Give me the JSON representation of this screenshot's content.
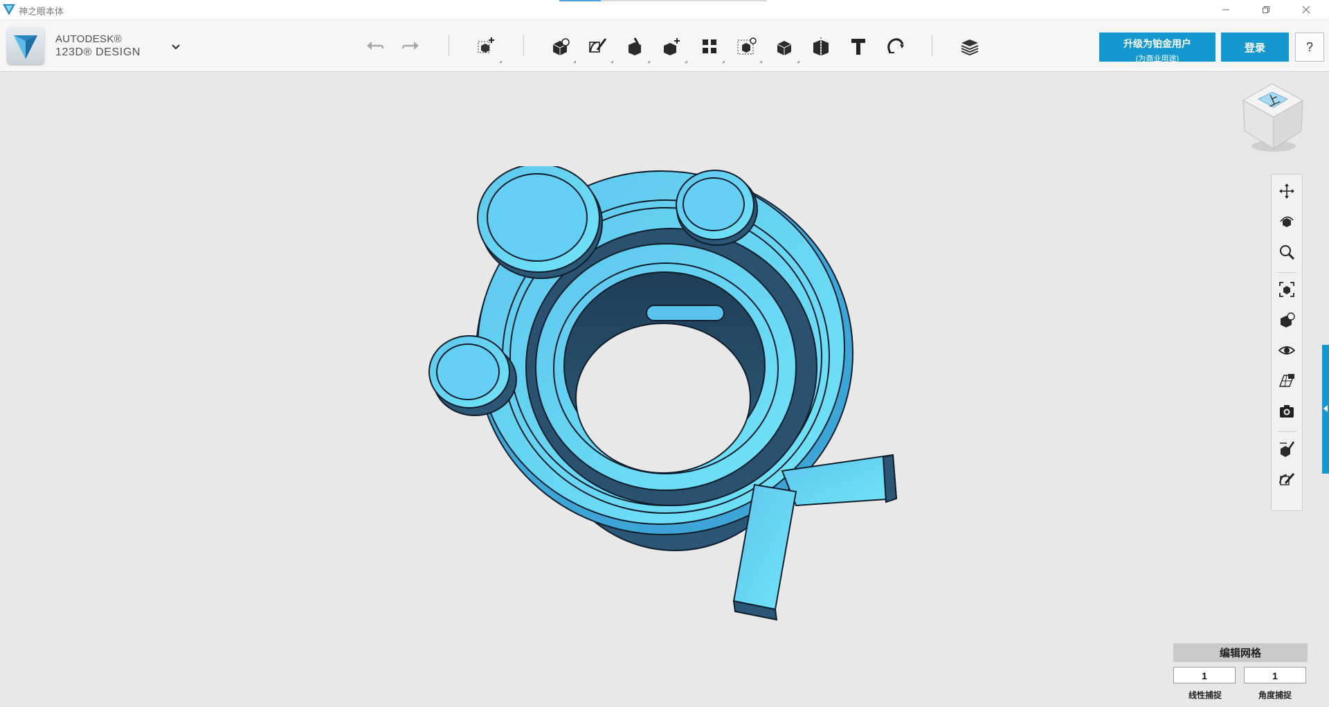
{
  "window": {
    "title": "神之眼本体",
    "controls": [
      "minimize-icon",
      "restore-icon",
      "close-icon"
    ]
  },
  "branding": {
    "line1": "AUTODESK®",
    "line2": "123D® DESIGN",
    "menu_icon": "chevron-down-icon"
  },
  "toolbar": {
    "history": [
      "undo-icon",
      "redo-icon"
    ],
    "groups": [
      [
        "transform-icon"
      ],
      [
        "primitives-icon",
        "sketch-icon",
        "construct-icon",
        "modify-icon",
        "pattern-icon",
        "grouping-icon",
        "combine-icon",
        "measure-icon",
        "text-icon",
        "snap-icon"
      ],
      [
        "material-icon"
      ]
    ],
    "upgrade_label": "升级为铂金用户",
    "upgrade_sublabel": "(为商业用途)",
    "login_label": "登录",
    "help_label": "?"
  },
  "view_cube": {
    "face": "上"
  },
  "navigation": {
    "tools": [
      "pan-icon",
      "orbit-icon",
      "zoom-icon",
      "fit-icon",
      "view-mode-icon",
      "visibility-icon",
      "material-render-icon",
      "screenshot-icon",
      "snap-settings-icon",
      "camera-icon"
    ]
  },
  "grid_panel": {
    "title": "编辑网格",
    "linear_snap_value": "1",
    "angle_snap_value": "1",
    "linear_snap_label": "线性捕捉",
    "angle_snap_label": "角度捕捉"
  },
  "colors": {
    "accent": "#1597cf",
    "model": "#5ecdf5",
    "viewport": "#e8e8e8"
  }
}
